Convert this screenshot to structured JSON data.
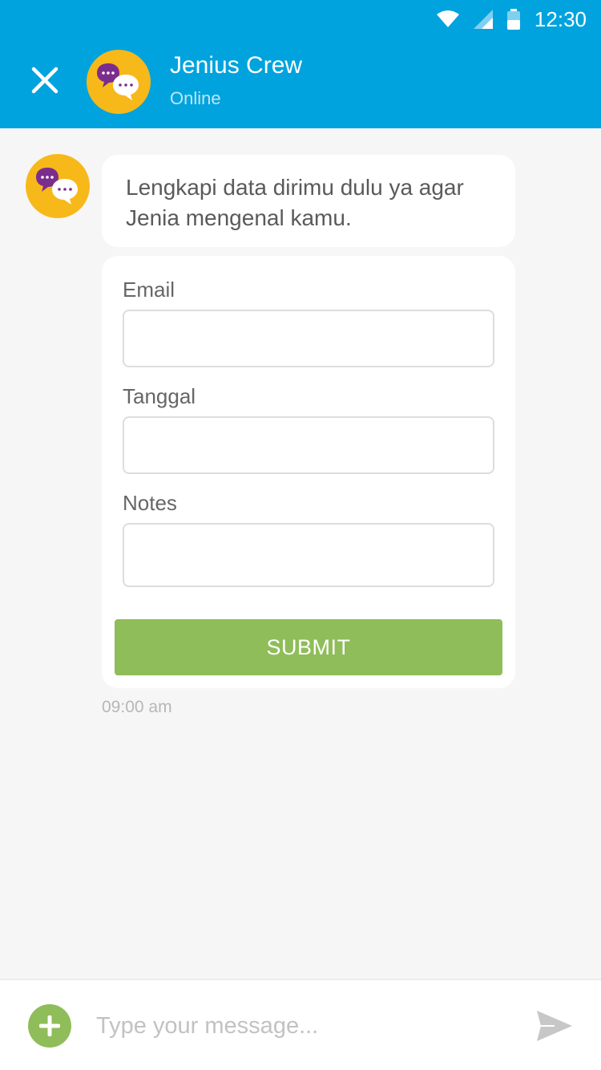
{
  "status_bar": {
    "time": "12:30"
  },
  "header": {
    "title": "Jenius Crew",
    "subtitle": "Online",
    "close_icon": "close-icon",
    "avatar_icon": "chat-bubbles-icon"
  },
  "conversation": {
    "bot_message": "Lengkapi data dirimu dulu ya agar Jenia mengenal kamu.",
    "form": {
      "fields": [
        {
          "label": "Email",
          "value": ""
        },
        {
          "label": "Tanggal",
          "value": ""
        },
        {
          "label": "Notes",
          "value": ""
        }
      ],
      "submit_label": "SUBMIT"
    },
    "timestamp": "09:00 am"
  },
  "composer": {
    "placeholder": "Type your message...",
    "add_icon": "plus-icon",
    "send_icon": "send-icon"
  },
  "colors": {
    "header_bg": "#00a3dd",
    "accent_green": "#8fbd59",
    "avatar_yellow": "#f7b81a",
    "bubble_purple": "#7b2d8e"
  }
}
